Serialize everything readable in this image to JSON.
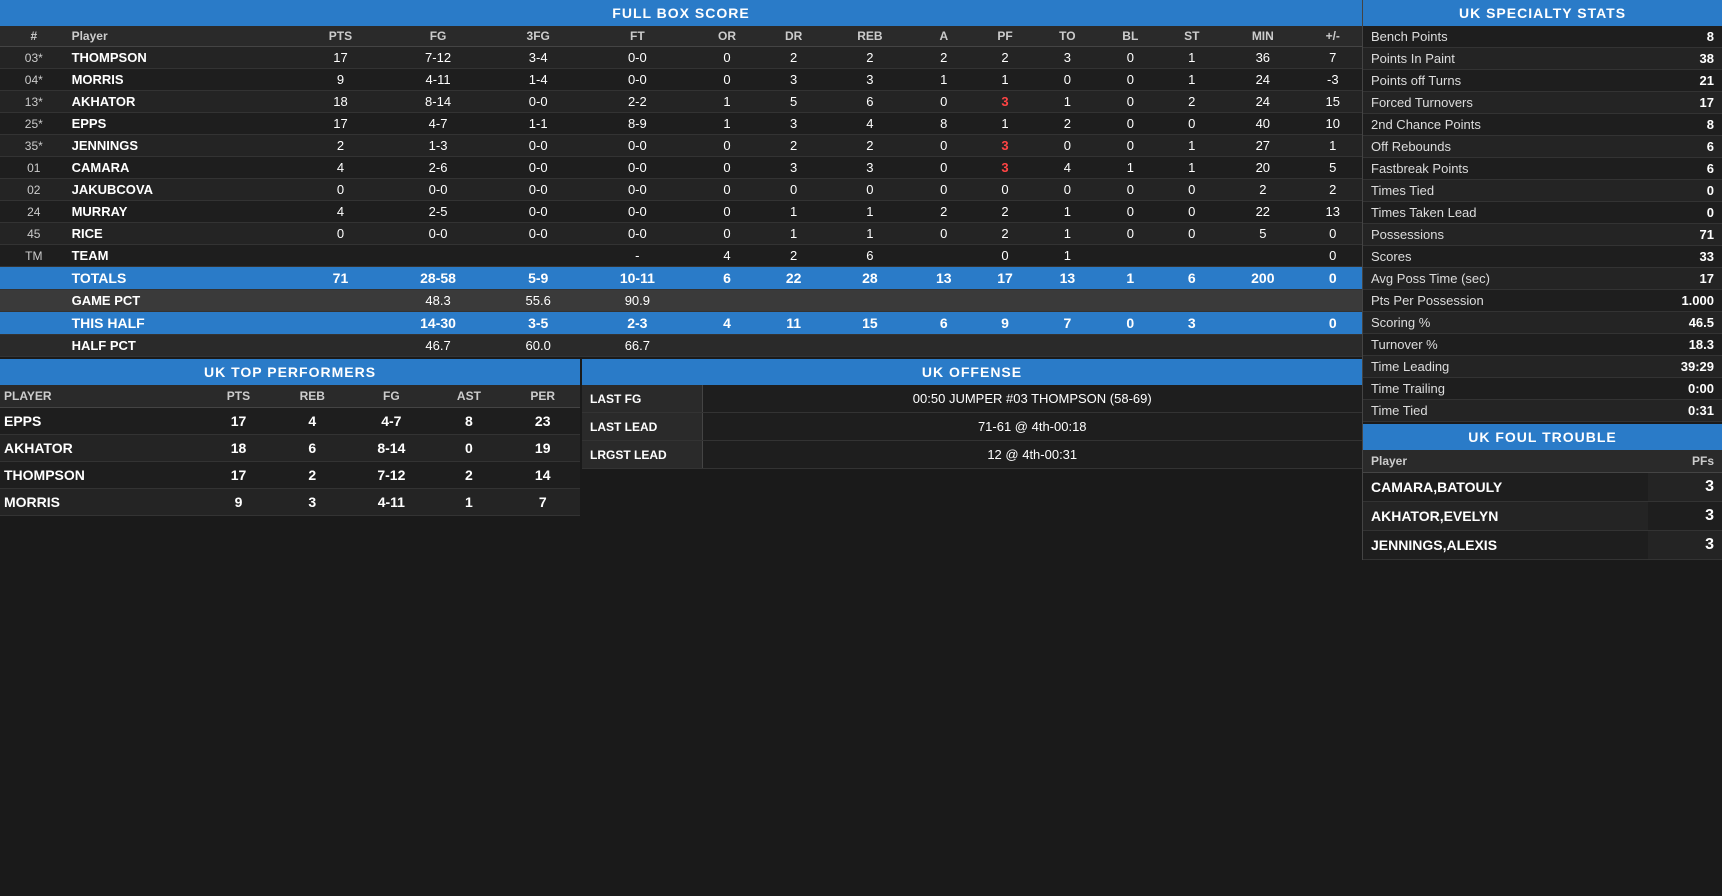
{
  "boxScore": {
    "title": "FULL BOX SCORE",
    "headers": [
      "#",
      "Player",
      "PTS",
      "FG",
      "3FG",
      "FT",
      "OR",
      "DR",
      "REB",
      "A",
      "PF",
      "TO",
      "BL",
      "ST",
      "MIN",
      "+/-"
    ],
    "players": [
      {
        "num": "03*",
        "name": "THOMPSON",
        "pts": "17",
        "fg": "7-12",
        "tfg": "3-4",
        "ft": "0-0",
        "or": "0",
        "dr": "2",
        "reb": "2",
        "a": "2",
        "pf": "2",
        "pfRed": false,
        "to": "3",
        "bl": "0",
        "st": "1",
        "min": "36",
        "pm": "7"
      },
      {
        "num": "04*",
        "name": "MORRIS",
        "pts": "9",
        "fg": "4-11",
        "tfg": "1-4",
        "ft": "0-0",
        "or": "0",
        "dr": "3",
        "reb": "3",
        "a": "1",
        "pf": "1",
        "pfRed": false,
        "to": "0",
        "bl": "0",
        "st": "1",
        "min": "24",
        "pm": "-3"
      },
      {
        "num": "13*",
        "name": "AKHATOR",
        "pts": "18",
        "fg": "8-14",
        "tfg": "0-0",
        "ft": "2-2",
        "or": "1",
        "dr": "5",
        "reb": "6",
        "a": "0",
        "pf": "3",
        "pfRed": true,
        "to": "1",
        "bl": "0",
        "st": "2",
        "min": "24",
        "pm": "15"
      },
      {
        "num": "25*",
        "name": "EPPS",
        "pts": "17",
        "fg": "4-7",
        "tfg": "1-1",
        "ft": "8-9",
        "or": "1",
        "dr": "3",
        "reb": "4",
        "a": "8",
        "pf": "1",
        "pfRed": false,
        "to": "2",
        "bl": "0",
        "st": "0",
        "min": "40",
        "pm": "10"
      },
      {
        "num": "35*",
        "name": "JENNINGS",
        "pts": "2",
        "fg": "1-3",
        "tfg": "0-0",
        "ft": "0-0",
        "or": "0",
        "dr": "2",
        "reb": "2",
        "a": "0",
        "pf": "3",
        "pfRed": true,
        "to": "0",
        "bl": "0",
        "st": "1",
        "min": "27",
        "pm": "1"
      },
      {
        "num": "01",
        "name": "CAMARA",
        "pts": "4",
        "fg": "2-6",
        "tfg": "0-0",
        "ft": "0-0",
        "or": "0",
        "dr": "3",
        "reb": "3",
        "a": "0",
        "pf": "3",
        "pfRed": true,
        "to": "4",
        "bl": "1",
        "st": "1",
        "min": "20",
        "pm": "5"
      },
      {
        "num": "02",
        "name": "JAKUBCOVA",
        "pts": "0",
        "fg": "0-0",
        "tfg": "0-0",
        "ft": "0-0",
        "or": "0",
        "dr": "0",
        "reb": "0",
        "a": "0",
        "pf": "0",
        "pfRed": false,
        "to": "0",
        "bl": "0",
        "st": "0",
        "min": "2",
        "pm": "2"
      },
      {
        "num": "24",
        "name": "MURRAY",
        "pts": "4",
        "fg": "2-5",
        "tfg": "0-0",
        "ft": "0-0",
        "or": "0",
        "dr": "1",
        "reb": "1",
        "a": "2",
        "pf": "2",
        "pfRed": false,
        "to": "1",
        "bl": "0",
        "st": "0",
        "min": "22",
        "pm": "13"
      },
      {
        "num": "45",
        "name": "RICE",
        "pts": "0",
        "fg": "0-0",
        "tfg": "0-0",
        "ft": "0-0",
        "or": "0",
        "dr": "1",
        "reb": "1",
        "a": "0",
        "pf": "2",
        "pfRed": false,
        "to": "1",
        "bl": "0",
        "st": "0",
        "min": "5",
        "pm": "0"
      },
      {
        "num": "TM",
        "name": "TEAM",
        "pts": "",
        "fg": "",
        "tfg": "",
        "ft": "-",
        "or": "4",
        "dr": "2",
        "reb": "6",
        "a": "",
        "pf": "0",
        "pfRed": false,
        "to": "1",
        "bl": "",
        "st": "",
        "min": "",
        "pm": "0"
      }
    ],
    "totals": {
      "label": "TOTALS",
      "pts": "71",
      "fg": "28-58",
      "tfg": "5-9",
      "ft": "10-11",
      "or": "6",
      "dr": "22",
      "reb": "28",
      "a": "13",
      "pf": "17",
      "to": "13",
      "bl": "1",
      "st": "6",
      "min": "200",
      "pm": "0"
    },
    "gamePct": {
      "label": "GAME PCT",
      "fg": "48.3",
      "tfg": "55.6",
      "ft": "90.9"
    },
    "thisHalf": {
      "label": "THIS HALF",
      "fg": "14-30",
      "tfg": "3-5",
      "ft": "2-3",
      "or": "4",
      "dr": "11",
      "reb": "15",
      "a": "6",
      "pf": "9",
      "to": "7",
      "bl": "0",
      "st": "3",
      "pm": "0"
    },
    "halfPct": {
      "label": "HALF PCT",
      "fg": "46.7",
      "tfg": "60.0",
      "ft": "66.7"
    }
  },
  "specialtyStats": {
    "title": "UK SPECIALTY STATS",
    "items": [
      {
        "label": "Bench Points",
        "value": "8"
      },
      {
        "label": "Points In Paint",
        "value": "38"
      },
      {
        "label": "Points off Turns",
        "value": "21"
      },
      {
        "label": "Forced Turnovers",
        "value": "17"
      },
      {
        "label": "2nd Chance Points",
        "value": "8"
      },
      {
        "label": "Off Rebounds",
        "value": "6"
      },
      {
        "label": "Fastbreak Points",
        "value": "6"
      },
      {
        "label": "Times Tied",
        "value": "0"
      },
      {
        "label": "Times Taken Lead",
        "value": "0"
      },
      {
        "label": "Possessions",
        "value": "71"
      },
      {
        "label": "Scores",
        "value": "33"
      },
      {
        "label": "Avg Poss Time (sec)",
        "value": "17"
      },
      {
        "label": "Pts Per Possession",
        "value": "1.000"
      },
      {
        "label": "Scoring %",
        "value": "46.5"
      },
      {
        "label": "Turnover %",
        "value": "18.3"
      },
      {
        "label": "Time Leading",
        "value": "39:29"
      },
      {
        "label": "Time Trailing",
        "value": "0:00"
      },
      {
        "label": "Time Tied",
        "value": "0:31"
      }
    ]
  },
  "topPerformers": {
    "title": "UK TOP PERFORMERS",
    "headers": [
      "PLAYER",
      "PTS",
      "REB",
      "FG",
      "AST",
      "PER"
    ],
    "players": [
      {
        "name": "EPPS",
        "pts": "17",
        "reb": "4",
        "fg": "4-7",
        "ast": "8",
        "per": "23"
      },
      {
        "name": "AKHATOR",
        "pts": "18",
        "reb": "6",
        "fg": "8-14",
        "ast": "0",
        "per": "19"
      },
      {
        "name": "THOMPSON",
        "pts": "17",
        "reb": "2",
        "fg": "7-12",
        "ast": "2",
        "per": "14"
      },
      {
        "name": "MORRIS",
        "pts": "9",
        "reb": "3",
        "fg": "4-11",
        "ast": "1",
        "per": "7"
      }
    ]
  },
  "offense": {
    "title": "UK OFFENSE",
    "rows": [
      {
        "label": "LAST FG",
        "value": "00:50 JUMPER #03 THOMPSON (58-69)"
      },
      {
        "label": "LAST LEAD",
        "value": "71-61 @ 4th-00:18"
      },
      {
        "label": "LRGST LEAD",
        "value": "12 @ 4th-00:31"
      }
    ]
  },
  "foulTrouble": {
    "title": "UK FOUL TROUBLE",
    "headers": [
      "Player",
      "PFs"
    ],
    "players": [
      {
        "name": "CAMARA,BATOULY",
        "pfs": "3"
      },
      {
        "name": "AKHATOR,EVELYN",
        "pfs": "3"
      },
      {
        "name": "JENNINGS,ALEXIS",
        "pfs": "3"
      }
    ]
  }
}
